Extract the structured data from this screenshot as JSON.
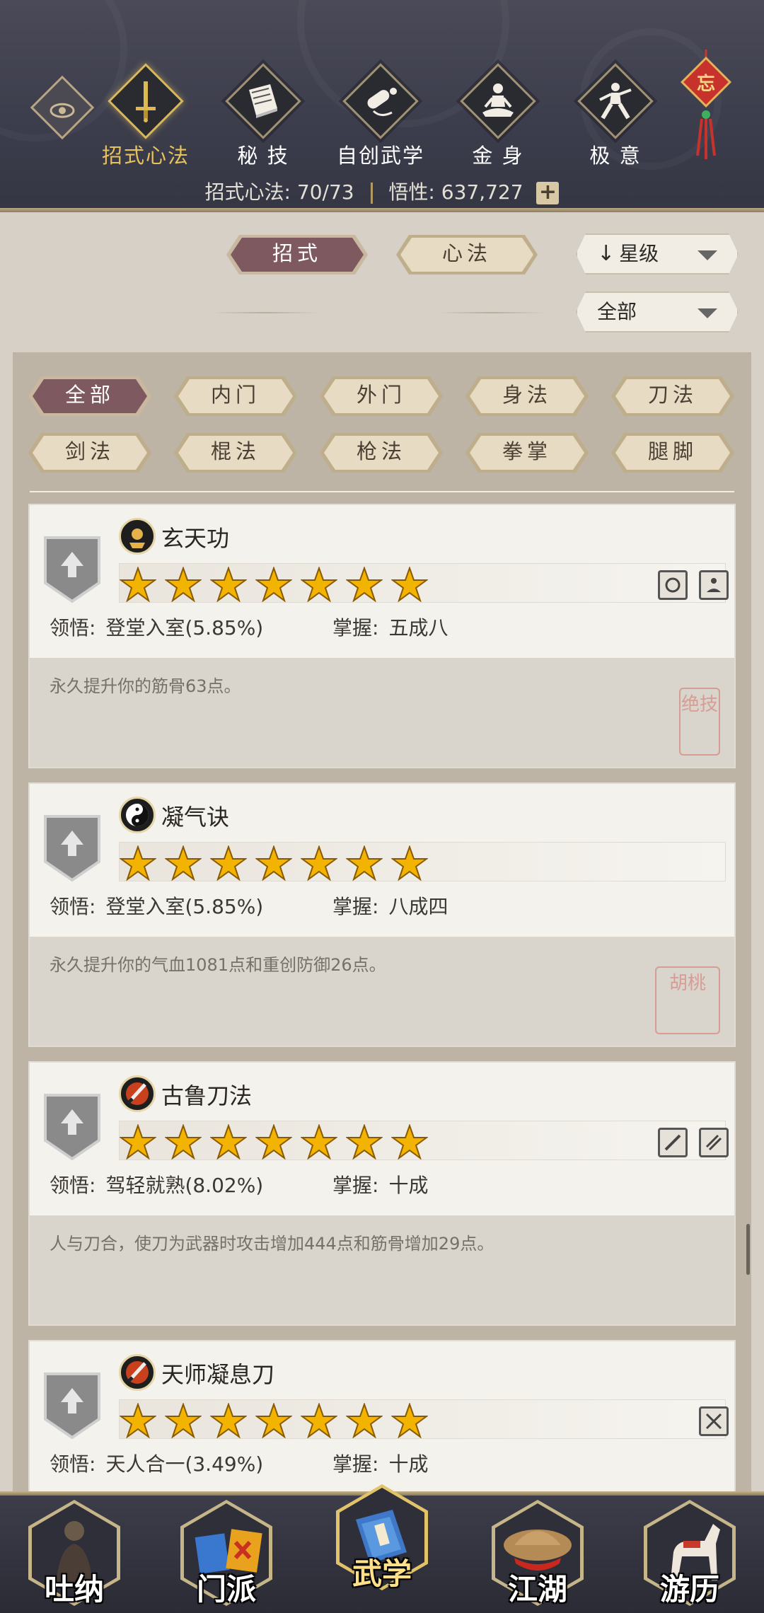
{
  "header": {
    "tabs": [
      {
        "label": "招式心法",
        "icon": "sword-icon",
        "active": true
      },
      {
        "label": "秘 技",
        "icon": "book-icon",
        "active": false
      },
      {
        "label": "自创武学",
        "icon": "scroll-icon",
        "active": false
      },
      {
        "label": "金 身",
        "icon": "meditation-icon",
        "active": false
      },
      {
        "label": "极 意",
        "icon": "martial-stance-icon",
        "active": false
      }
    ],
    "knot_char": "忘",
    "stats": {
      "moves_label": "招式心法:",
      "moves_value": "70/73",
      "insight_label": "悟性:",
      "insight_value": "637,727",
      "plus": "+"
    }
  },
  "filters": {
    "type_tabs": [
      {
        "label": "招式",
        "active": true
      },
      {
        "label": "心法",
        "active": false
      }
    ],
    "sort_dropdown": "星级",
    "scope_dropdown": "全部",
    "categories": [
      {
        "label": "全部",
        "active": true
      },
      {
        "label": "内门",
        "active": false
      },
      {
        "label": "外门",
        "active": false
      },
      {
        "label": "身法",
        "active": false
      },
      {
        "label": "刀法",
        "active": false
      },
      {
        "label": "剑法",
        "active": false
      },
      {
        "label": "棍法",
        "active": false
      },
      {
        "label": "枪法",
        "active": false
      },
      {
        "label": "拳掌",
        "active": false
      },
      {
        "label": "腿脚",
        "active": false
      }
    ]
  },
  "skills": [
    {
      "name": "玄天功",
      "stars": 7,
      "comprehension_label": "领悟:",
      "comprehension": "登堂入室(5.85%)",
      "mastery_label": "掌握:",
      "mastery": "五成八",
      "description": "永久提升你的筋骨63点。",
      "seal": "绝技",
      "icon": "golden-gong-icon",
      "badges": [
        "gear-badge-icon",
        "sitting-badge-icon"
      ]
    },
    {
      "name": "凝气诀",
      "stars": 7,
      "comprehension_label": "领悟:",
      "comprehension": "登堂入室(5.85%)",
      "mastery_label": "掌握:",
      "mastery": "八成四",
      "description": "永久提升你的气血1081点和重创防御26点。",
      "seal": "胡桃",
      "icon": "yin-yang-icon",
      "badges": []
    },
    {
      "name": "古鲁刀法",
      "stars": 7,
      "comprehension_label": "领悟:",
      "comprehension": "驾轻就熟(8.02%)",
      "mastery_label": "掌握:",
      "mastery": "十成",
      "description": "人与刀合，使刀为武器时攻击增加444点和筋骨增加29点。",
      "seal": "",
      "icon": "blade-icon",
      "badges": [
        "blade-badge-icon",
        "slash-badge-icon"
      ]
    },
    {
      "name": "天师凝息刀",
      "stars": 7,
      "comprehension_label": "领悟:",
      "comprehension": "天人合一(3.49%)",
      "mastery_label": "掌握:",
      "mastery": "十成",
      "description": "",
      "seal": "",
      "icon": "blade-icon",
      "badges": [
        "cross-blade-badge-icon"
      ]
    }
  ],
  "bottom_nav": [
    {
      "label": "吐纳",
      "icon": "monk-icon",
      "active": false
    },
    {
      "label": "门派",
      "icon": "sect-banner-icon",
      "active": false
    },
    {
      "label": "武学",
      "icon": "martial-manual-icon",
      "active": true
    },
    {
      "label": "江湖",
      "icon": "straw-hat-icon",
      "active": false
    },
    {
      "label": "游历",
      "icon": "horse-icon",
      "active": false
    }
  ],
  "colors": {
    "accent_gold": "#e8c25a",
    "active_tab": "#7e5a60",
    "header_bg": "#3c3d4c",
    "star": "#f2b400"
  }
}
